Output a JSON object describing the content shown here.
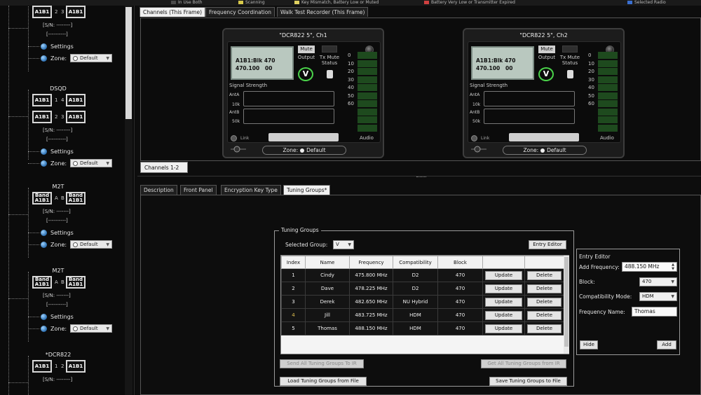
{
  "legend": [
    {
      "label": "In Use Both",
      "color": "#4a4a4a"
    },
    {
      "label": "Scanning",
      "color": "#d8c94a"
    },
    {
      "label": "Key Mismatch, Battery Low or Muted",
      "color": "#e0d060"
    },
    {
      "label": "Battery Very Low or Transmitter Expired",
      "color": "#d04040"
    },
    {
      "label": "Selected Radio",
      "color": "#3a6fd0"
    }
  ],
  "tree": {
    "devices": [
      {
        "title": "",
        "rows": [
          [
            "A1B1",
            "2",
            "3",
            "A1B1"
          ]
        ],
        "sn": "[S/N: --------]",
        "dash": "[----------]",
        "settings": "Settings",
        "zone_label": "Zone:",
        "zone_value": "Default"
      },
      {
        "title": "DSQD",
        "rows": [
          [
            "A1B1",
            "1",
            "4",
            "A1B1"
          ],
          [
            "A1B1",
            "2",
            "3",
            "A1B1"
          ]
        ],
        "sn": "[S/N: --------]",
        "dash": "[----------]",
        "settings": "Settings",
        "zone_label": "Zone:",
        "zone_value": "Default"
      },
      {
        "title": "M2T",
        "rows": [
          [
            "Band\nA1B1",
            "A",
            "B",
            "Band\nA1B1"
          ]
        ],
        "sn": "[S/N: -------]",
        "dash": "[----------]",
        "settings": "Settings",
        "zone_label": "Zone:",
        "zone_value": "Default"
      },
      {
        "title": "M2T",
        "rows": [
          [
            "Band\nA1B1",
            "A",
            "B",
            "Band\nA1B1"
          ]
        ],
        "sn": "[S/N: -------]",
        "dash": "[----------]",
        "settings": "Settings",
        "zone_label": "Zone:",
        "zone_value": "Default"
      },
      {
        "title": "*DCR822",
        "rows": [
          [
            "A1B1",
            "1",
            "2",
            "A1B1"
          ]
        ],
        "sn": "[S/N: --------]",
        "dash": "",
        "settings": "",
        "zone_label": "",
        "zone_value": ""
      }
    ]
  },
  "top_tabs": [
    "Channels (This Frame)",
    "Frequency Coordination",
    "Walk Test Recorder (This Frame)"
  ],
  "receivers": [
    {
      "title": "\"DCR822 5\", Ch1",
      "lcd_line1": "A1B1:Blk 470",
      "lcd_line2": "470.100   00",
      "mute": "Mute",
      "output": "Output",
      "tx_mute_status": "Tx Mute\nStatus",
      "signal_strength": "Signal Strength",
      "ant_a": "AntA",
      "ant_b": "AntB",
      "k10": "10k",
      "k50": "50k",
      "scale": [
        "0",
        "10",
        "20",
        "30",
        "40",
        "50",
        "60"
      ],
      "audio": "Audio",
      "link": "Link",
      "zone": "Zone:",
      "zone_value": "Default"
    },
    {
      "title": "\"DCR822 5\", Ch2",
      "lcd_line1": "A1B1:Blk 470",
      "lcd_line2": "470.100   00",
      "mute": "Mute",
      "output": "Output",
      "tx_mute_status": "Tx Mute\nStatus",
      "signal_strength": "Signal Strength",
      "ant_a": "AntA",
      "ant_b": "AntB",
      "k10": "10k",
      "k50": "50k",
      "scale": [
        "0",
        "10",
        "20",
        "30",
        "40",
        "50",
        "60"
      ],
      "audio": "Audio",
      "link": "Link",
      "zone": "Zone:",
      "zone_value": "Default"
    }
  ],
  "sub_tab": "Channels 1-2",
  "bottom_tabs": [
    "Description",
    "Front Panel",
    "Encryption Key Type",
    "Tuning Groups*"
  ],
  "tuning_groups": {
    "legend": "Tuning Groups",
    "selected_group_label": "Selected Group:",
    "selected_group_value": "V",
    "entry_editor_button": "Entry Editor",
    "columns": [
      "Index",
      "Name",
      "Frequency",
      "Compatibility",
      "Block",
      "",
      ""
    ],
    "rows": [
      {
        "index": "1",
        "name": "Cindy",
        "frequency": "475.800 MHz",
        "compat": "D2",
        "block": "470",
        "update": "Update",
        "delete": "Delete"
      },
      {
        "index": "2",
        "name": "Dave",
        "frequency": "478.225 MHz",
        "compat": "D2",
        "block": "470",
        "update": "Update",
        "delete": "Delete"
      },
      {
        "index": "3",
        "name": "Derek",
        "frequency": "482.650 MHz",
        "compat": "NU Hybrid",
        "block": "470",
        "update": "Update",
        "delete": "Delete"
      },
      {
        "index": "4",
        "name": "Jill",
        "frequency": "483.725 MHz",
        "compat": "HDM",
        "block": "470",
        "update": "Update",
        "delete": "Delete"
      },
      {
        "index": "5",
        "name": "Thomas",
        "frequency": "488.150 MHz",
        "compat": "HDM",
        "block": "470",
        "update": "Update",
        "delete": "Delete"
      }
    ],
    "send_all": "Send All Tuning Groups To IR",
    "get_all": "Get All Tuning Groups from IR",
    "load": "Load Tuning Groups from File",
    "save": "Save Tuning Groups to File"
  },
  "entry_editor": {
    "title": "Entry Editor",
    "add_frequency_label": "Add Frequency:",
    "add_frequency_value": "488.150 MHz",
    "block_label": "Block:",
    "block_value": "470",
    "compat_label": "Compatibility Mode:",
    "compat_value": "HDM",
    "freq_name_label": "Frequency Name:",
    "freq_name_value": "Thomas",
    "hide": "Hide",
    "add": "Add"
  }
}
